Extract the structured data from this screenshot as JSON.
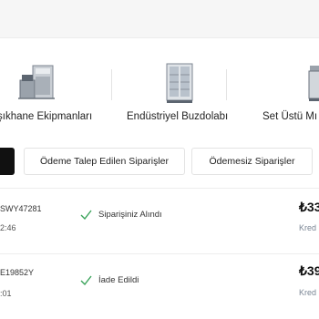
{
  "categories": [
    {
      "label": "şıkhane Ekipmanları",
      "icon": "dishwasher-icon"
    },
    {
      "label": "Endüstriyel Buzdolabı",
      "icon": "refrigerator-icon"
    },
    {
      "label": "Set Üstü Mı",
      "icon": "countertop-machine-icon"
    }
  ],
  "tabs": {
    "payment_requested": "Ödeme Talep Edilen Siparişler",
    "unpaid": "Ödemesiz Siparişler"
  },
  "orders": [
    {
      "code": "SWY47281",
      "time": "2:46",
      "status": "Siparişiniz Alındı",
      "price": "₺33",
      "payment": "Kred"
    },
    {
      "code": "E19852Y",
      "time": ":01",
      "status": "İade Edildi",
      "price": "₺39",
      "payment": "Kred"
    }
  ],
  "colors": {
    "accent_green": "#3aa35a",
    "active_tab": "#111111"
  }
}
